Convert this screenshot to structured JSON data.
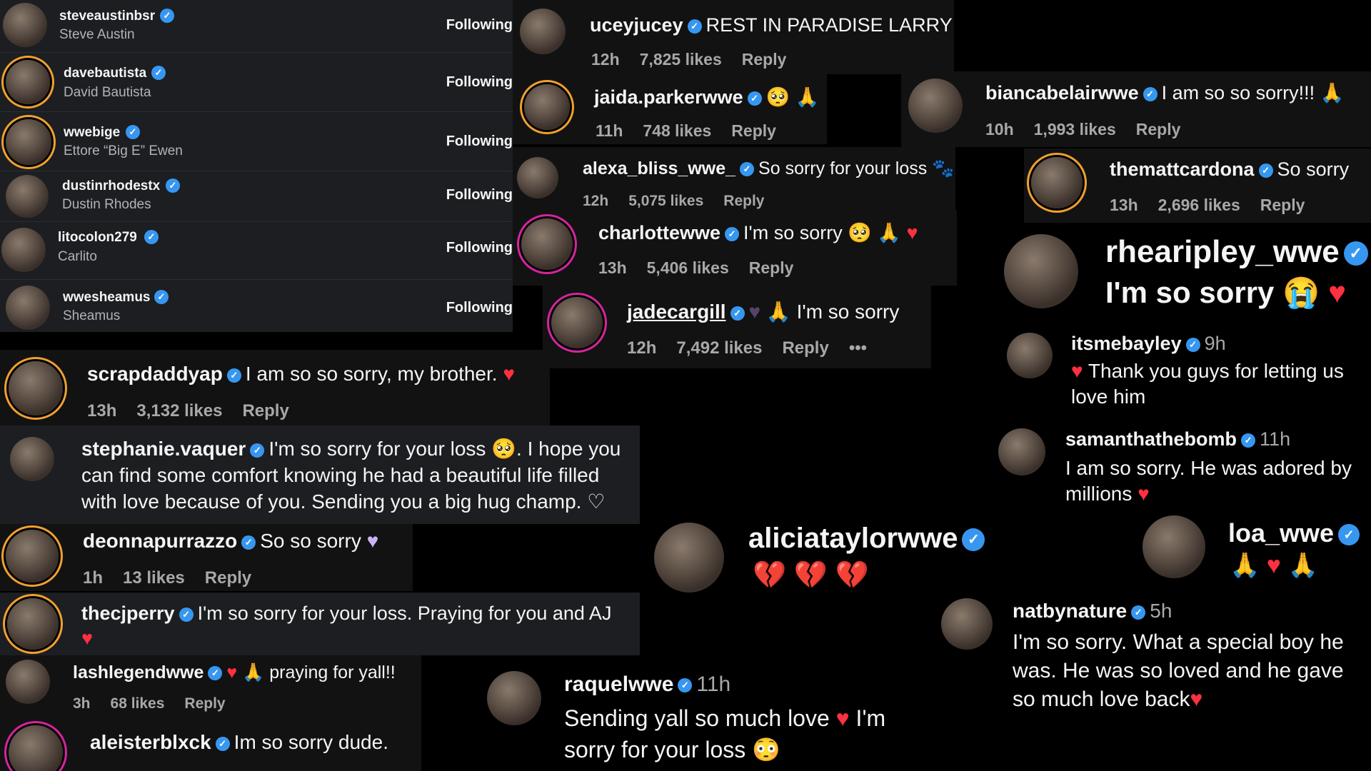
{
  "following_list": [
    {
      "username": "steveaustinbsr",
      "name": "Steve Austin",
      "button": "Following"
    },
    {
      "username": "davebautista",
      "name": "David Bautista",
      "button": "Following"
    },
    {
      "username": "wwebige",
      "name": "Ettore “Big E” Ewen",
      "button": "Following"
    },
    {
      "username": "dustinrhodestx",
      "name": "Dustin Rhodes",
      "button": "Following"
    },
    {
      "username": "litocolon279",
      "name": "Carlito",
      "button": "Following"
    },
    {
      "username": "wwesheamus",
      "name": "Sheamus",
      "button": "Following"
    }
  ],
  "reply_label": "Reply",
  "more_label": "•••",
  "comments": {
    "uceyjucey": {
      "user": "uceyjucey",
      "text": "REST IN PARADISE LARRY",
      "time": "12h",
      "likes": "7,825 likes"
    },
    "jaida": {
      "user": "jaida.parkerwwe",
      "time": "11h",
      "likes": "748 likes"
    },
    "bianca": {
      "user": "biancabelairwwe",
      "text": "I am so so sorry!!!",
      "time": "10h",
      "likes": "1,993 likes"
    },
    "alexa": {
      "user": "alexa_bliss_wwe_",
      "text": "So sorry for your loss",
      "time": "12h",
      "likes": "5,075 likes"
    },
    "cardona": {
      "user": "themattcardona",
      "text": "So sorry",
      "time": "13h",
      "likes": "2,696 likes"
    },
    "charlotte": {
      "user": "charlottewwe",
      "text": "I'm so sorry",
      "time": "13h",
      "likes": "5,406 likes"
    },
    "rhea": {
      "user": "rhearipley_wwe",
      "text": "I'm so sorry"
    },
    "jade": {
      "user": "jadecargill",
      "text": "I'm so sorry",
      "time": "12h",
      "likes": "7,492 likes"
    },
    "bayley": {
      "user": "itsmebayley",
      "time": "9h",
      "text": "Thank you guys for letting us love him"
    },
    "scrap": {
      "user": "scrapdaddyap",
      "text": "I am so so sorry, my brother.",
      "time": "13h",
      "likes": "3,132 likes"
    },
    "samantha": {
      "user": "samanthathebomb",
      "time": "11h",
      "text": "I am so sorry. He was adored by millions"
    },
    "stephanie": {
      "user": "stephanie.vaquer",
      "text": "I'm so sorry for your loss",
      "text2": ". I hope you can find some comfort knowing he had a beautiful life filled with love because of you. Sending you a big hug champ."
    },
    "deonna": {
      "user": "deonnapurrazzo",
      "text": "So so sorry",
      "time": "1h",
      "likes": "13 likes"
    },
    "alicia": {
      "user": "aliciataylorwwe"
    },
    "loa": {
      "user": "loa_wwe"
    },
    "cjperry": {
      "user": "thecjperry",
      "text": "I'm so sorry for your loss. Praying for you and AJ"
    },
    "nat": {
      "user": "natbynature",
      "time": "5h",
      "text": "I'm so sorry. What a special boy he was. He was so loved and he gave so much love back"
    },
    "lashley": {
      "user": "lashlegendwwe",
      "text": "praying for yall!!",
      "time": "3h",
      "likes": "68 likes"
    },
    "raquel": {
      "user": "raquelwwe",
      "time": "11h",
      "text": "Sending yall so much love",
      "text2": "I'm sorry for your loss"
    },
    "aleister": {
      "user": "aleisterblxck",
      "text": "Im so sorry dude."
    }
  },
  "icons": {
    "verified": "verified-badge",
    "heart": "red-heart",
    "pray": "praying-hands",
    "broken": "broken-heart"
  }
}
